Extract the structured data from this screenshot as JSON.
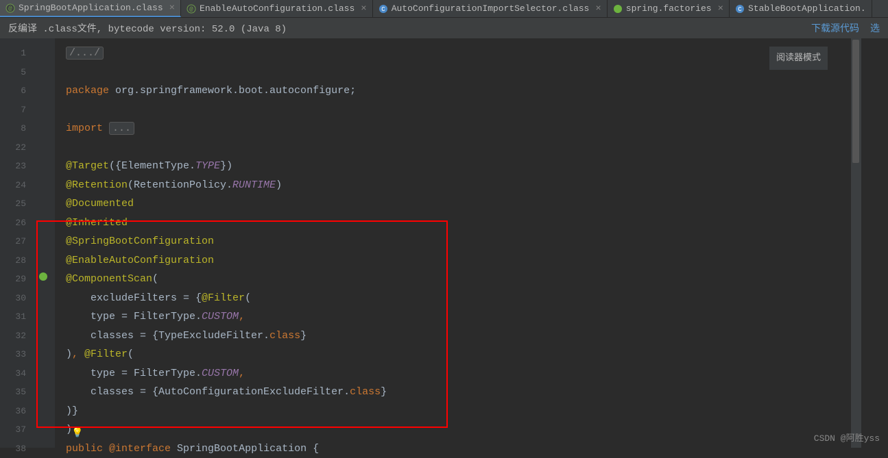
{
  "tabs": [
    {
      "label": "SpringBootApplication.class",
      "icon": "annotation",
      "active": true
    },
    {
      "label": "EnableAutoConfiguration.class",
      "icon": "annotation",
      "active": false
    },
    {
      "label": "AutoConfigurationImportSelector.class",
      "icon": "class",
      "active": false
    },
    {
      "label": "spring.factories",
      "icon": "spring",
      "active": false
    },
    {
      "label": "StableBootApplication.",
      "icon": "class",
      "active": false
    }
  ],
  "info_bar": {
    "text": "反编译 .class文件, bytecode version: 52.0 (Java 8)",
    "link1": "下载源代码",
    "link2": "选"
  },
  "reader_mode": "阅读器模式",
  "line_numbers": [
    "1",
    "5",
    "6",
    "7",
    "8",
    "22",
    "23",
    "24",
    "25",
    "26",
    "27",
    "28",
    "29",
    "30",
    "31",
    "32",
    "33",
    "34",
    "35",
    "36",
    "37",
    "38"
  ],
  "code": {
    "l1_comment": "/.../",
    "l6_package": "package",
    "l6_pkg": " org.springframework.boot.autoconfigure",
    "l8_import": "import",
    "l8_dots": "...",
    "l23_anno": "@Target",
    "l23_rest": "({ElementType.",
    "l23_type": "TYPE",
    "l23_end": "})",
    "l24_anno": "@Retention",
    "l24_rest": "(RetentionPolicy.",
    "l24_type": "RUNTIME",
    "l24_end": ")",
    "l25": "@Documented",
    "l26": "@Inherited",
    "l27": "@SpringBootConfiguration",
    "l28": "@EnableAutoConfiguration",
    "l29_anno": "@ComponentScan",
    "l29_end": "(",
    "l30_a": "    excludeFilters = {",
    "l30_anno": "@Filter",
    "l30_end": "(",
    "l31_a": "    type = FilterType.",
    "l31_type": "CUSTOM",
    "l31_end": ",",
    "l32_a": "    classes = {TypeExcludeFilter.",
    "l32_kw": "class",
    "l32_end": "}",
    "l33_a": ")",
    "l33_b": ",",
    "l33_anno": " @Filter",
    "l33_end": "(",
    "l34_a": "    type = FilterType.",
    "l34_type": "CUSTOM",
    "l34_end": ",",
    "l35_a": "    classes = {AutoConfigurationExcludeFilter.",
    "l35_kw": "class",
    "l35_end": "}",
    "l36": ")}",
    "l37": ")",
    "l38_kw1": "public",
    "l38_kw2": " @interface",
    "l38_name": " SpringBootApplication",
    "l38_end": " {"
  },
  "watermark": "CSDN @阿胜yss"
}
